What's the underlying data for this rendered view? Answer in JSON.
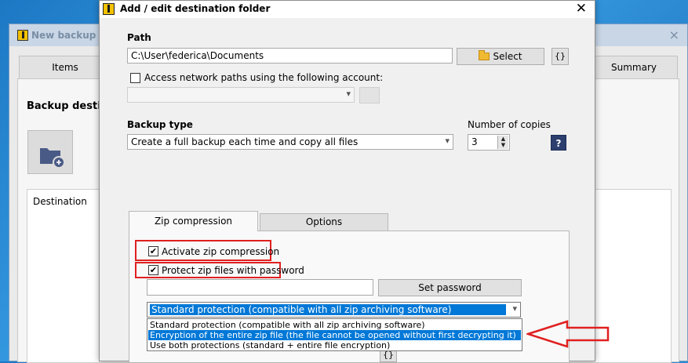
{
  "background_window": {
    "title": "New backup job",
    "close_glyph": "×",
    "tabs": {
      "items": "Items",
      "summary": "Summary"
    },
    "section_title": "Backup destinat",
    "list_header_destination": "Destination"
  },
  "dialog": {
    "title": "Add / edit destination folder",
    "close_glyph": "✕",
    "path": {
      "label": "Path",
      "value": "C:\\User\\federica\\Documents",
      "select_button": "Select",
      "vars_button": "{}"
    },
    "network": {
      "checkbox_label": "Access network paths using the following account:",
      "checked": false,
      "selected_account": ""
    },
    "backup_type": {
      "label": "Backup type",
      "value": "Create a full backup each time and copy all files"
    },
    "copies": {
      "label": "Number of copies",
      "value": "3"
    },
    "help_button": "?",
    "tabs": {
      "zip": "Zip compression",
      "options": "Options"
    },
    "zip": {
      "activate_label": "Activate zip compression",
      "activate_checked": true,
      "protect_label": "Protect zip files with password",
      "protect_checked": true,
      "password_value": "",
      "set_password_button": "Set password",
      "protection_selected": "Standard protection (compatible with all zip archiving software)",
      "protection_options": [
        "Standard protection (compatible with all zip archiving software)",
        "Encryption of the entire zip file (the file cannot be opened without first decrypting it)",
        "Use both protections (standard + entire file encryption)"
      ],
      "highlighted_option_index": 1,
      "bottom_vars_button": "{}"
    }
  },
  "colors": {
    "annotation_red": "#e02020",
    "selection_blue": "#0078d7",
    "help_button_navy": "#2c3e6e"
  },
  "icons": [
    "app-icon",
    "close-icon",
    "folder-icon",
    "folder-add-icon",
    "chevron-down-icon",
    "spin-updown-icon",
    "help-icon",
    "checkmark-icon",
    "arrow-annotation"
  ]
}
